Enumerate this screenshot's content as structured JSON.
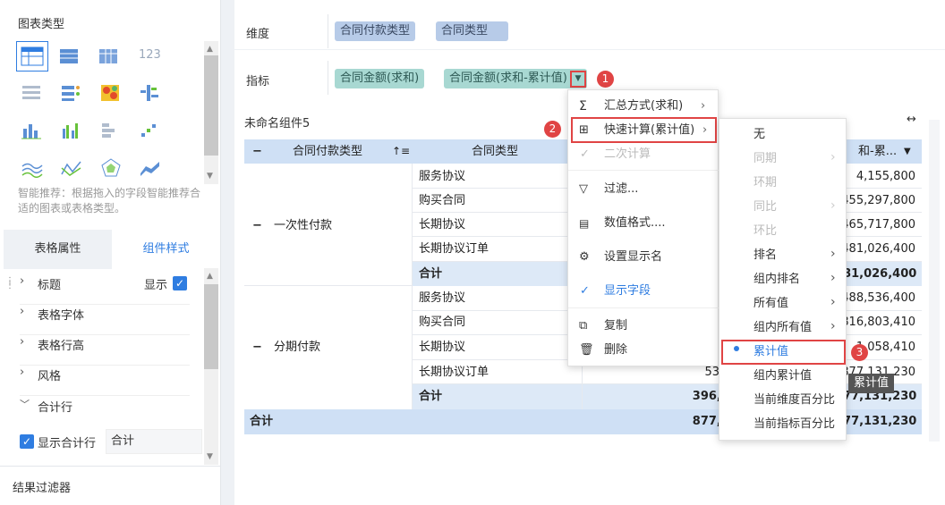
{
  "left_panel": {
    "chart_type_title": "图表类型",
    "smart_tip": "智能推荐：根据拖入的字段智能推荐合适的图表或表格类型。",
    "tabs": [
      "表格属性",
      "组件样式"
    ],
    "props": [
      {
        "label": "标题",
        "extra": "显示"
      },
      {
        "label": "表格字体"
      },
      {
        "label": "表格行高"
      },
      {
        "label": "风格"
      },
      {
        "label": "合计行"
      }
    ],
    "show_total_row": "显示合计行",
    "total_input_value": "合计",
    "result_filter": "结果过滤器"
  },
  "dimension": {
    "label": "维度",
    "chips": [
      "合同付款类型",
      "合同类型"
    ]
  },
  "measure": {
    "label": "指标",
    "chips": [
      "合同金额(求和)",
      "合同金额(求和-累计值)"
    ]
  },
  "component_title": "未命名组件5",
  "table": {
    "headers": [
      "合同付款类型",
      "合同类型",
      "和-累..."
    ],
    "group1": {
      "name": "一次性付款",
      "rows": [
        {
          "type": "服务协议",
          "v2": "4,155,800"
        },
        {
          "type": "购买合同",
          "v2": "455,297,800"
        },
        {
          "type": "长期协议",
          "v2": "465,717,800"
        },
        {
          "type": "长期协议订单",
          "v2": "481,026,400"
        },
        {
          "type": "合计",
          "v2": "481,026,400"
        }
      ]
    },
    "group2": {
      "name": "分期付款",
      "rows": [
        {
          "type": "服务协议",
          "v1": "",
          "v2": "488,536,400"
        },
        {
          "type": "购买合同",
          "v1": "",
          "v2": "816,803,410"
        },
        {
          "type": "长期协议",
          "v1": "",
          "v2": "1,058,410"
        },
        {
          "type": "长期协议订单",
          "v1": "53,072",
          "v2": "877,131,230"
        },
        {
          "type": "合计",
          "v1": "396,104",
          "v2": "877,131,230"
        }
      ]
    },
    "grand_total": {
      "label": "合计",
      "v1": "877,131",
      "v2": "877,131,230"
    }
  },
  "menu1": {
    "items": [
      {
        "label": "汇总方式(求和)",
        "icon": "sigma-icon"
      },
      {
        "label": "快速计算(累计值)",
        "icon": "calc-icon"
      },
      {
        "label": "二次计算",
        "icon": "check-icon"
      },
      {
        "label": "过滤...",
        "icon": "filter-icon"
      },
      {
        "label": "数值格式....",
        "icon": "number-format-icon"
      },
      {
        "label": "设置显示名",
        "icon": "gear-icon"
      },
      {
        "label": "显示字段",
        "icon": "check-icon"
      },
      {
        "label": "复制",
        "icon": "copy-icon"
      },
      {
        "label": "删除",
        "icon": "trash-icon"
      }
    ]
  },
  "menu2": {
    "items": [
      "无",
      "同期",
      "环期",
      "同比",
      "环比",
      "排名",
      "组内排名",
      "所有值",
      "组内所有值",
      "累计值",
      "组内累计值",
      "当前维度百分比",
      "当前指标百分比"
    ]
  },
  "tooltip": "累计值",
  "badges": [
    "1",
    "2",
    "3"
  ],
  "colors": {
    "accent": "#2f7de1",
    "red": "#e04444",
    "header_bg": "#cfe0f5",
    "total_bg": "#dde9f7"
  }
}
